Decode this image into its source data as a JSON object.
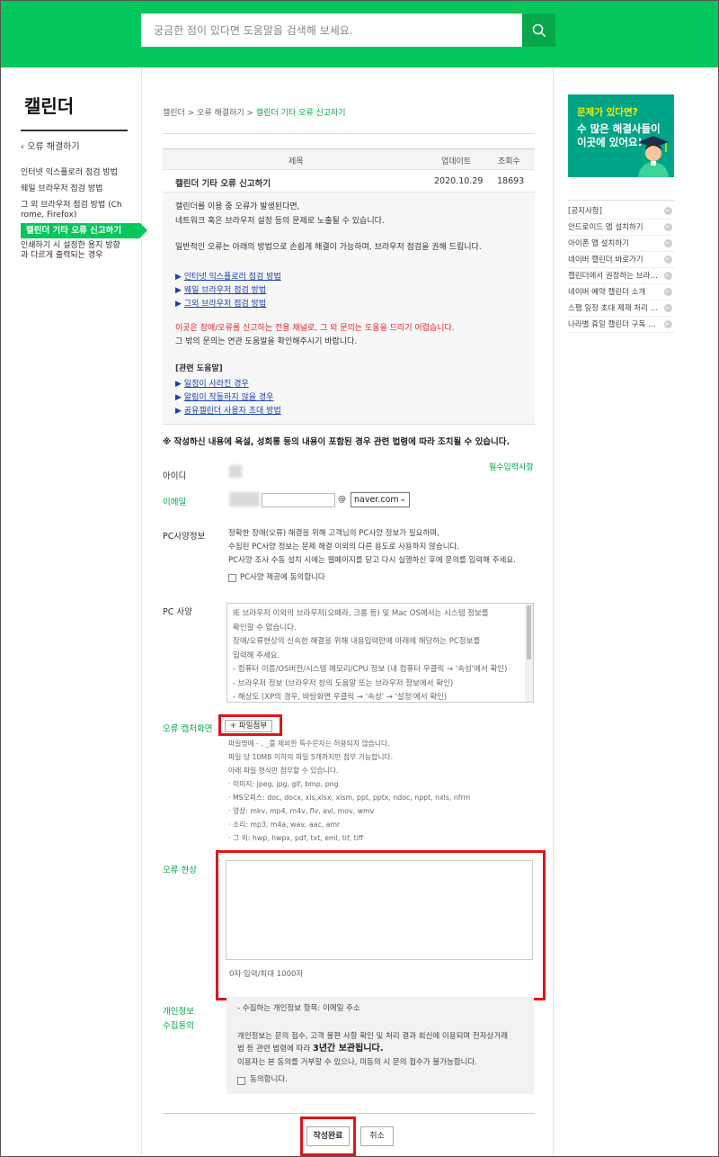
{
  "header": {
    "search_placeholder": "궁금한 점이 있다면 도움말을 검색해 보세요."
  },
  "lnb": {
    "title": "캘린더",
    "back": "오류 해결하기",
    "items": [
      "인터넷 익스플로러 점검 방법",
      "웨일 브라우저 점검 방법",
      "그 외 브라우저 점검 방법 (Ch",
      "rome, Firefox)",
      "캘린더 기타 오류 신고하기",
      "인쇄하기 시 설정한 용지 방향",
      "과 다르게 출력되는 경우"
    ]
  },
  "breadcrumb": {
    "part1": "캘린더",
    "sep": " > ",
    "part2": "오류 해결하기",
    "current": "캘린더 기타 오류 신고하기"
  },
  "table": {
    "headers": [
      "제목",
      "업데이트",
      "조회수"
    ],
    "row": {
      "title": "캘린더 기타 오류 신고하기",
      "date": "2020.10.29",
      "views": "18693"
    }
  },
  "article": {
    "p1": "캘린더를 이용 중 오류가 발생된다면,",
    "p2": "네트워크 혹은 브라우저 설정 등의 문제로 노출될 수 있습니다.",
    "p3": "일반적인 오류는 아래의 방법으로 손쉽게 해결이 가능하며, 브라우저 점검을 권해 드립니다.",
    "links": [
      "인터넷 익스플로러 점검 방법",
      "웨일 브라우저 점검 방법",
      "그외 브라우저 점검 방법"
    ],
    "notice_red": "이곳은 장애/오류를 신고하는 전용 채널로, 그 외 문의는 도움을 드리기 어렵습니다.",
    "notice2": "그 밖의 문의는 연관 도움말을 확인해주시기 바랍니다.",
    "related_title": "[관련 도움말]",
    "related": [
      "일정이 사라진 경우",
      "알림이 작동하지 않을 경우",
      "공유캘린더 사용자 초대 방법"
    ]
  },
  "form": {
    "warning": "※ 작성하신 내용에 욕설, 성희롱 등의 내용이 포함된 경우 관련 법령에 따라 조치될 수 있습니다.",
    "required": "필수입력사항",
    "id_label": "아이디",
    "email_label": "이메일",
    "at": "@",
    "email_domain": "naver.com",
    "pcinfo_label": "PC사양정보",
    "pcinfo_lines": [
      "정확한 장애(오류) 해결을 위해 고객님의 PC사양 정보가 필요하며,",
      "수집된 PC사양 정보는 문제 해결 이외의 다른 용도로 사용하지 않습니다.",
      "PC사양 조사 수동 설치 시에는 웹페이지를 닫고 다시 실행하신 후에 문의를 입력해 주세요."
    ],
    "pcinfo_agree": "PC사양 제공에 동의합니다",
    "pcspec_label": "PC 사양",
    "pcspec_lines": [
      "IE 브라우저 이외의 브라우저(오페라, 크롬 등) 및 Mac OS에서는 시스템 정보를",
      "확인할 수 없습니다.",
      "장애/오류현상의 신속한 해결을 위해 내용입력란에 아래에 해당하는 PC정보를",
      "입력해 주세요.",
      "- 컴퓨터 이름/OS버전/시스템 메모리/CPU 정보 (내 컴퓨터 우클릭 → '속성'에서 확인)",
      "- 브라우저 정보 (브라우저 창의 도움말 또는 브라우저 정보에서 확인)",
      "- 해상도 (XP의 경우, 바탕화면 우클릭 → '속성' → '설정'에서 확인)"
    ],
    "capture_label": "오류 캡처화면",
    "attach_plus": "+",
    "attach_button": "파일첨부",
    "file_rules": [
      "파일명에 - , _를 제외한 특수문자는 허용되지 않습니다.",
      "파일 당 10MB 이하의 파일 5개까지만 첨부 가능합니다.",
      "아래 파일 형식만 첨부할 수 있습니다.",
      "· 이미지: jpeg, jpg, gif, bmp, png",
      "· MS오피스: doc, docx, xls,xlsx, xlsm, ppt, pptx, ndoc, nppt, nxls, nfrm",
      "· 영상: mkv, mp4, m4v, flv, avi, mov, wmv",
      "· 소리: mp3, m4a, wav, aac, amr",
      "· 그 외: hwp, hwpx, pdf, txt, eml, tif, tiff"
    ],
    "error_label": "오류 현상",
    "counter": "0자 입력/최대 1000자",
    "consent_label1": "개인정보",
    "consent_label2": "수집동의",
    "consent_item": "- 수집하는 개인정보 항목: 이메일 주소",
    "consent_p1": "개인정보는 문의 접수, 고객 불편 사항 확인 및 처리 결과 회신에 이용되며 전자상거래",
    "consent_p2_a": "법 등 관련 법령에 따라 ",
    "consent_p2_b": "3년간 보관됩니다.",
    "consent_p3": "이용자는 본 동의를 거부할 수 있으나, 미동의 시 문의 접수가 불가능합니다.",
    "consent_agree": "동의합니다.",
    "submit": "작성완료",
    "cancel": "취소"
  },
  "side": {
    "banner_t1": "문제가 있다면?",
    "banner_t2": "수 많은 해결사들이",
    "banner_t3": "이곳에 있어요!",
    "items": [
      "[공지사항]",
      "안드로이드 앱 설치하기",
      "아이폰 앱 설치하기",
      "네이버 캘린더 바로가기",
      "캘린더에서 권장하는 브라…",
      "네이버 예약 캘린더 소개",
      "스팸 일정 초대 제재 처리 …",
      "나라별 휴일 캘린더 구독 …"
    ]
  },
  "colors": {
    "brand": "#03c75a",
    "highlight": "#e0141c",
    "link": "#1a3fb0"
  }
}
